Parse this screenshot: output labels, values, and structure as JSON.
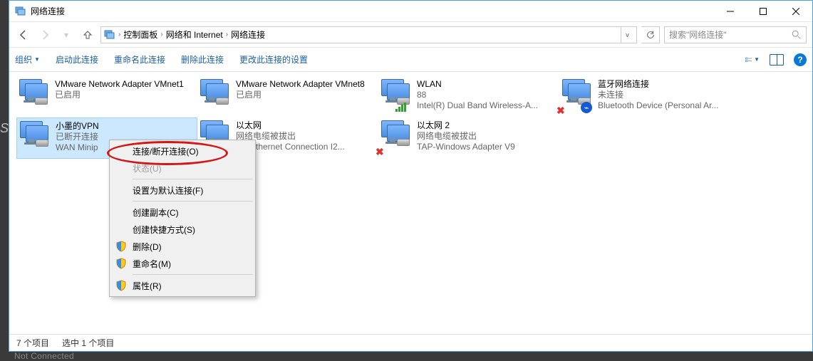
{
  "window": {
    "title": "网络连接"
  },
  "breadcrumb": {
    "seg1": "控制面板",
    "seg2": "网络和 Internet",
    "seg3": "网络连接"
  },
  "search": {
    "placeholder": "搜索\"网络连接\""
  },
  "toolbar": {
    "organize": "组织",
    "start": "启动此连接",
    "rename": "重命名此连接",
    "delete": "删除此连接",
    "change": "更改此连接的设置"
  },
  "connections": [
    {
      "name": "VMware Network Adapter VMnet1",
      "status": "已启用",
      "device": ""
    },
    {
      "name": "VMware Network Adapter VMnet8",
      "status": "已启用",
      "device": ""
    },
    {
      "name": "WLAN",
      "status": "88",
      "device": "Intel(R) Dual Band Wireless-A..."
    },
    {
      "name": "蓝牙网络连接",
      "status": "未连接",
      "device": "Bluetooth Device (Personal Ar..."
    },
    {
      "name": "小墨的VPN",
      "status": "已断开连接",
      "device": "WAN Minip"
    },
    {
      "name": "以太网",
      "status": "网络电缆被拔出",
      "device": "(R) Ethernet Connection I2..."
    },
    {
      "name": "以太网 2",
      "status": "网络电缆被拔出",
      "device": "TAP-Windows Adapter V9"
    }
  ],
  "context_menu": {
    "connect": "连接/断开连接(O)",
    "status": "状态(U)",
    "default": "设置为默认连接(F)",
    "copy": "创建副本(C)",
    "shortcut": "创建快捷方式(S)",
    "delete": "删除(D)",
    "rename": "重命名(M)",
    "props": "属性(R)"
  },
  "statusbar": {
    "total": "7 个项目",
    "selected": "选中 1 个项目"
  },
  "background": {
    "notconn": "Not Connected"
  }
}
